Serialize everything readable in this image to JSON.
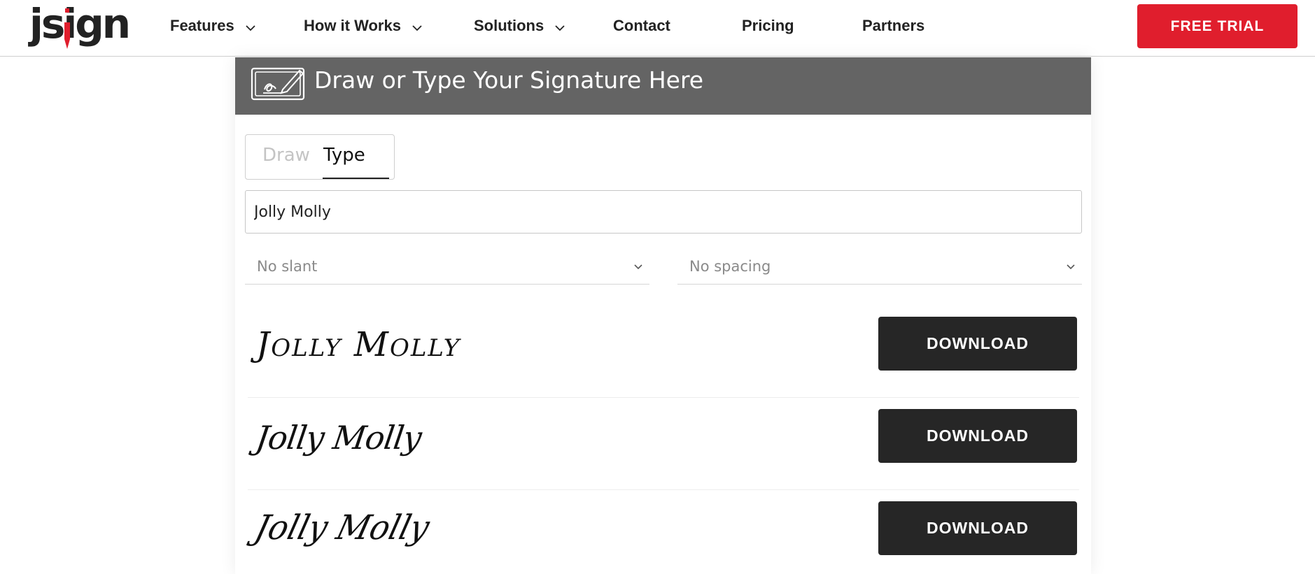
{
  "header": {
    "logo_text": "jsign",
    "nav": [
      {
        "label": "Features",
        "has_dropdown": true
      },
      {
        "label": "How it Works",
        "has_dropdown": true
      },
      {
        "label": "Solutions",
        "has_dropdown": true
      },
      {
        "label": "Contact",
        "has_dropdown": false
      },
      {
        "label": "Pricing",
        "has_dropdown": false
      },
      {
        "label": "Partners",
        "has_dropdown": false
      }
    ],
    "cta_label": "FREE TRIAL",
    "cta_color": "#e01e2d"
  },
  "panel": {
    "title": "Draw or Type Your Signature Here",
    "header_icon": "signature-pad-icon",
    "tabs": [
      {
        "label": "Draw",
        "active": false
      },
      {
        "label": "Type",
        "active": true
      }
    ],
    "name_value": "Jolly Molly",
    "slant_select": "No slant",
    "spacing_select": "No spacing",
    "signatures": [
      {
        "text": "Jolly Molly",
        "button": "DOWNLOAD"
      },
      {
        "text": "Jolly Molly",
        "button": "DOWNLOAD"
      },
      {
        "text": "Jolly Molly",
        "button": "DOWNLOAD"
      }
    ]
  }
}
